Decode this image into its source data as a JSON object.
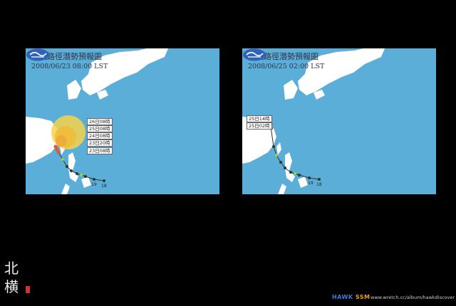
{
  "maps": [
    {
      "title": "颱風路徑潛勢預報圖",
      "time": "2008/06/23 08:00 LST",
      "time_labels": [
        "26日08時",
        "25日08時",
        "24日08時",
        "23日20時",
        "23日08時"
      ],
      "marks": [
        "19",
        "18"
      ]
    },
    {
      "title": "颱風路徑潛勢預報圖",
      "time": "2008/06/25 02:00 LST",
      "time_labels": [
        "25日14時",
        "25日02時"
      ],
      "marks": [
        "19",
        "18"
      ]
    }
  ],
  "footer": {
    "calligraphy_line1": "北",
    "calligraphy_line2": "横",
    "brand_part1": "HAWK",
    "brand_part2": "SSM",
    "url": "www.wretch.cc/album/hawkdiscover"
  },
  "colors": {
    "ocean": "#5aaed8",
    "land": "#ffffff",
    "potential_area": "#f6d24a",
    "track_dot": "#2a3a2a",
    "forecast_dot": "#e05a2a",
    "logo": "#2f62b8"
  },
  "icons": {
    "logo": "cwb-logo-icon"
  }
}
